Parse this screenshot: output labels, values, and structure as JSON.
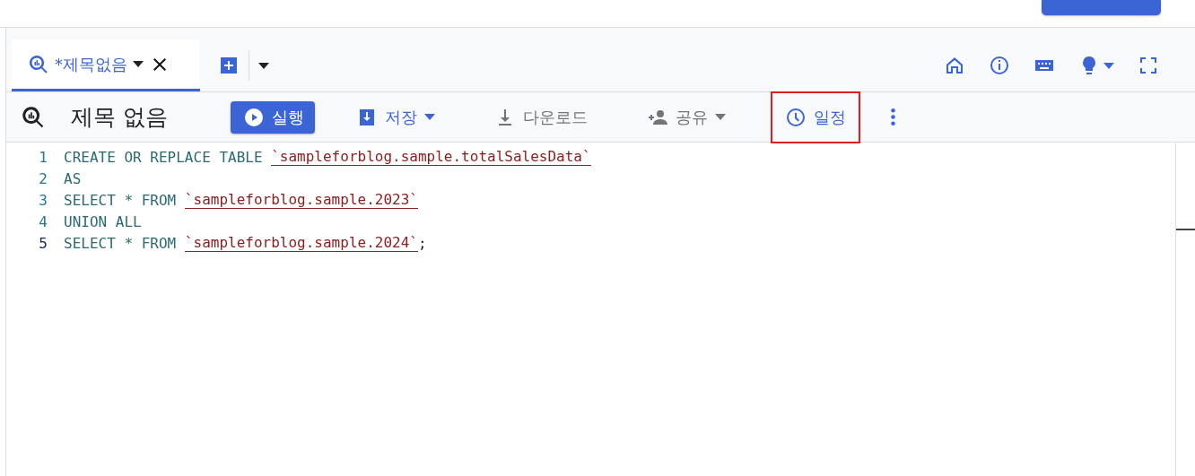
{
  "tabs": [
    {
      "label": "*제목없음",
      "selected": true
    }
  ],
  "toolbar": {
    "title": "제목 없음",
    "buttons": [
      {
        "kind": "primary",
        "label": "실행",
        "dropdown": false,
        "disabled": false,
        "highlighted": false
      },
      {
        "kind": "text",
        "label": "저장",
        "dropdown": true,
        "disabled": false,
        "highlighted": false
      },
      {
        "kind": "text",
        "label": "다운로드",
        "dropdown": false,
        "disabled": true,
        "highlighted": false
      },
      {
        "kind": "text",
        "label": "공유",
        "dropdown": true,
        "disabled": true,
        "highlighted": false
      },
      {
        "kind": "text",
        "label": "일정",
        "dropdown": false,
        "disabled": false,
        "highlighted": true
      }
    ]
  },
  "editor": {
    "lines": [
      {
        "number": "1",
        "active": false,
        "tokens": [
          {
            "kind": "keyword",
            "text": "CREATE OR REPLACE TABLE "
          },
          {
            "kind": "string",
            "text": "`sampleforblog.sample.totalSalesData`"
          }
        ]
      },
      {
        "number": "2",
        "active": false,
        "tokens": [
          {
            "kind": "keyword",
            "text": "AS"
          }
        ]
      },
      {
        "number": "3",
        "active": false,
        "tokens": [
          {
            "kind": "keyword",
            "text": "SELECT * FROM "
          },
          {
            "kind": "string",
            "text": "`sampleforblog.sample.2023`"
          }
        ]
      },
      {
        "number": "4",
        "active": false,
        "tokens": [
          {
            "kind": "keyword",
            "text": "UNION ALL"
          }
        ]
      },
      {
        "number": "5",
        "active": true,
        "tokens": [
          {
            "kind": "keyword",
            "text": "SELECT * FROM "
          },
          {
            "kind": "string",
            "text": "`sampleforblog.sample.2024`"
          },
          {
            "kind": "plain",
            "text": ";"
          }
        ]
      }
    ]
  }
}
